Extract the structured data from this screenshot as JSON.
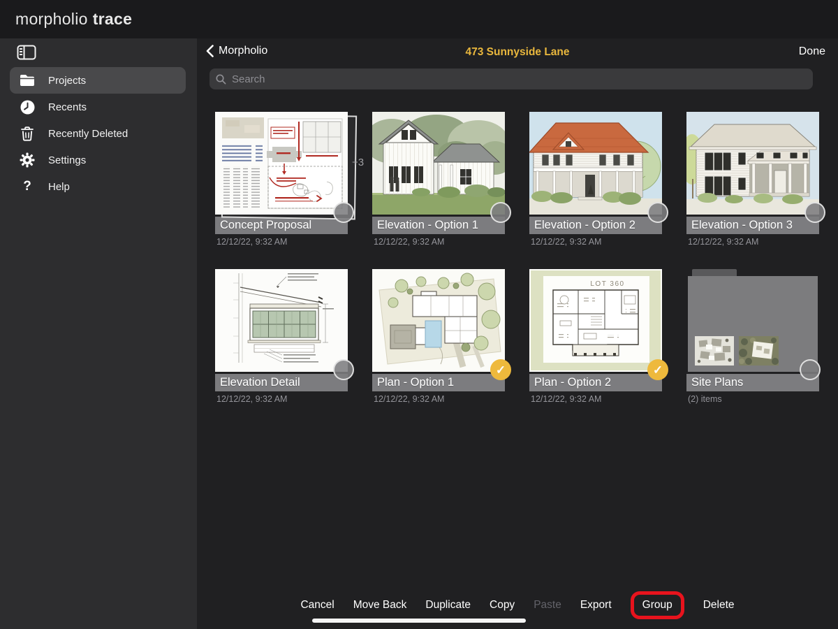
{
  "topbar": {
    "logo_regular": "morpholio",
    "logo_bold": "trace"
  },
  "sidebar": {
    "items": [
      {
        "label": "Projects",
        "icon": "folder-icon",
        "selected": true
      },
      {
        "label": "Recents",
        "icon": "clock-icon",
        "selected": false
      },
      {
        "label": "Recently Deleted",
        "icon": "trash-icon",
        "selected": false
      },
      {
        "label": "Settings",
        "icon": "gear-icon",
        "selected": false
      },
      {
        "label": "Help",
        "icon": "help-icon",
        "selected": false
      }
    ]
  },
  "header": {
    "back_label": "Morpholio",
    "title": "473 Sunnyside Lane",
    "done_label": "Done"
  },
  "search": {
    "placeholder": "Search"
  },
  "grid": {
    "items": [
      {
        "title": "Concept Proposal",
        "date": "12/12/22, 9:32 AM",
        "selected": false,
        "stack_badge": "+3"
      },
      {
        "title": "Elevation - Option 1",
        "date": "12/12/22, 9:32 AM",
        "selected": false
      },
      {
        "title": "Elevation - Option 2",
        "date": "12/12/22, 9:32 AM",
        "selected": false
      },
      {
        "title": "Elevation - Option 3",
        "date": "12/12/22, 9:32 AM",
        "selected": false
      },
      {
        "title": "Elevation Detail",
        "date": "12/12/22, 9:32 AM",
        "selected": false
      },
      {
        "title": "Plan - Option 1",
        "date": "12/12/22, 9:32 AM",
        "selected": true
      },
      {
        "title": "Plan - Option 2",
        "date": "12/12/22, 9:32 AM",
        "selected": true,
        "plan_label": "LOT 360"
      },
      {
        "title": "Site Plans",
        "subtitle": "(2) items",
        "selected": false,
        "is_group": true
      }
    ]
  },
  "toolbar": {
    "buttons": [
      {
        "label": "Cancel",
        "enabled": true
      },
      {
        "label": "Move Back",
        "enabled": true
      },
      {
        "label": "Duplicate",
        "enabled": true
      },
      {
        "label": "Copy",
        "enabled": true
      },
      {
        "label": "Paste",
        "enabled": false
      },
      {
        "label": "Export",
        "enabled": true
      },
      {
        "label": "Group",
        "enabled": true,
        "highlighted": true
      },
      {
        "label": "Delete",
        "enabled": true
      }
    ]
  },
  "colors": {
    "accent_yellow": "#e9b73d",
    "highlight_red": "#e8131d",
    "selected_row": "#49494b",
    "titlebar_gray": "#808083"
  }
}
